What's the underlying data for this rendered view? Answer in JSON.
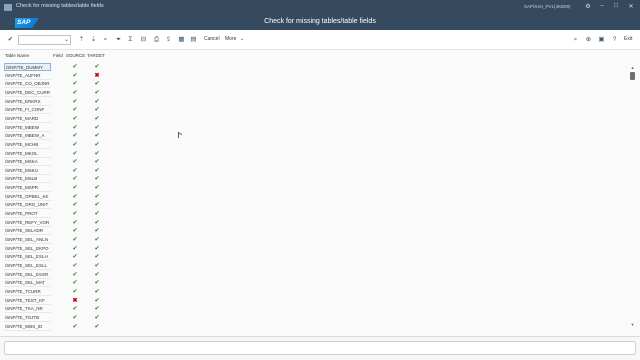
{
  "window": {
    "title": "Check for missing tables/table fields",
    "system": "SAP/S4H_PV1(4KB08)"
  },
  "shell": {
    "title": "Check for missing tables/table fields"
  },
  "toolbar": {
    "cancel_label": "Cancel",
    "more_label": "More",
    "exit_label": "Exit"
  },
  "table": {
    "headers": {
      "name": "Table Name",
      "field": "Field",
      "source": "SOURCE",
      "target": "TARGET"
    },
    "rows": [
      {
        "name": "/SNP/TE_DUMMY",
        "source": "ok",
        "target": "ok"
      },
      {
        "name": "/SNP/TE_AUFNR",
        "source": "ok",
        "target": "err"
      },
      {
        "name": "/SNP/TE_CO_OBJNR",
        "source": "ok",
        "target": "ok"
      },
      {
        "name": "/SNP/TE_DEC_CURR",
        "source": "ok",
        "target": "ok"
      },
      {
        "name": "/SNP/TE_ERKRS",
        "source": "ok",
        "target": "ok"
      },
      {
        "name": "/SNP/TE_FI_CONF",
        "source": "ok",
        "target": "ok"
      },
      {
        "name": "/SNP/TE_MARD",
        "source": "ok",
        "target": "ok"
      },
      {
        "name": "/SNP/TE_MBEW",
        "source": "ok",
        "target": "ok"
      },
      {
        "name": "/SNP/TE_MBEW_A",
        "source": "ok",
        "target": "ok"
      },
      {
        "name": "/SNP/TE_MCHB",
        "source": "ok",
        "target": "ok"
      },
      {
        "name": "/SNP/TE_MKOL",
        "source": "ok",
        "target": "ok"
      },
      {
        "name": "/SNP/TE_MSKA",
        "source": "ok",
        "target": "ok"
      },
      {
        "name": "/SNP/TE_MSKU",
        "source": "ok",
        "target": "ok"
      },
      {
        "name": "/SNP/TE_MSLB",
        "source": "ok",
        "target": "ok"
      },
      {
        "name": "/SNP/TE_MSPR",
        "source": "ok",
        "target": "ok"
      },
      {
        "name": "/SNP/TE_OPBEL_KK",
        "source": "ok",
        "target": "ok"
      },
      {
        "name": "/SNP/TE_ORG_UNIT",
        "source": "ok",
        "target": "ok"
      },
      {
        "name": "/SNP/TE_PROT",
        "source": "ok",
        "target": "ok"
      },
      {
        "name": "/SNP/TE_REFY_VOR",
        "source": "ok",
        "target": "ok"
      },
      {
        "name": "/SNP/TE_SELADR",
        "source": "ok",
        "target": "ok"
      },
      {
        "name": "/SNP/TE_SEL_ANLN",
        "source": "ok",
        "target": "ok"
      },
      {
        "name": "/SNP/TE_SEL_EKPO",
        "source": "ok",
        "target": "ok"
      },
      {
        "name": "/SNP/TE_SEL_ESLH",
        "source": "ok",
        "target": "ok"
      },
      {
        "name": "/SNP/TE_SEL_ESLL",
        "source": "ok",
        "target": "ok"
      },
      {
        "name": "/SNP/TE_SEL_ESSR",
        "source": "ok",
        "target": "ok"
      },
      {
        "name": "/SNP/TE_SEL_MAT",
        "source": "ok",
        "target": "ok"
      },
      {
        "name": "/SNP/TE_TCURR",
        "source": "ok",
        "target": "ok"
      },
      {
        "name": "/SNP/TE_TEST_KF",
        "source": "err",
        "target": "ok"
      },
      {
        "name": "/SNP/TE_TKA_NR",
        "source": "ok",
        "target": "ok"
      },
      {
        "name": "/SNP/TE_TOJTB",
        "source": "ok",
        "target": "ok"
      },
      {
        "name": "/SNP/TE_WBS_ID",
        "source": "ok",
        "target": "ok"
      }
    ]
  },
  "colors": {
    "shell": "#354a5f",
    "ok": "#2b7d2b",
    "err": "#bb0000"
  }
}
